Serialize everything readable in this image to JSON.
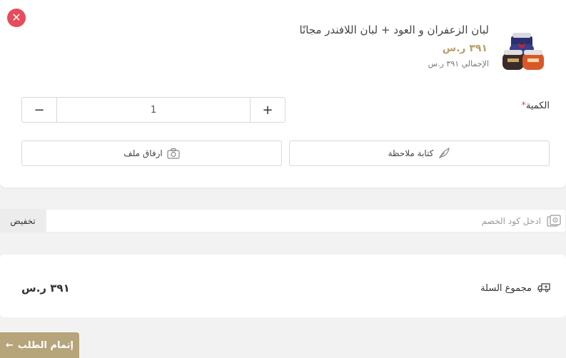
{
  "cart_item": {
    "title": "لبان الزعفران و العود + لبان اللافندر مجانًا",
    "price": "٣٩١ ر.س",
    "total": "الإجمالي ٣٩١ ر.س",
    "quantity_label": "الكمية",
    "required_mark": "*",
    "quantity_value": "1",
    "minus_symbol": "−",
    "plus_symbol": "+",
    "close_symbol": "✕",
    "note_button_label": "كتابة ملاحظة",
    "attach_button_label": "ارفاق ملف",
    "accent_color": "#e74c5b"
  },
  "discount": {
    "placeholder": "ادخل كود الخصم",
    "apply_label": "تخفيض"
  },
  "summary": {
    "label": "مجموع السلة",
    "amount": "٣٩١ ر.س"
  },
  "checkout": {
    "label": "إتمام الطلب",
    "arrow": "←",
    "color": "#b6a47a"
  }
}
